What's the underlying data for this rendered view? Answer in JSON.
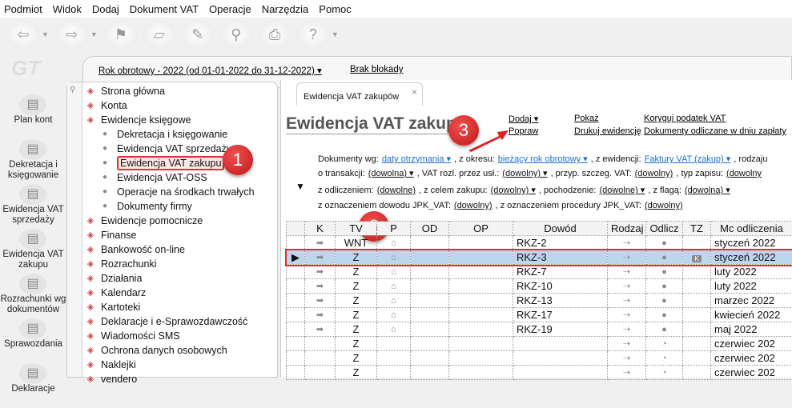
{
  "menu": [
    "Podmiot",
    "Widok",
    "Dodaj",
    "Dokument VAT",
    "Operacje",
    "Narzędzia",
    "Pomoc"
  ],
  "logo": "GT",
  "leftnav": [
    {
      "label": "Plan kont",
      "icon": "accounts-plan-icon"
    },
    {
      "label": "Dekretacja i księgowanie",
      "icon": "booking-icon"
    },
    {
      "label": "Ewidencja VAT sprzedaży",
      "icon": "vat-sales-icon"
    },
    {
      "label": "Ewidencja VAT zakupu",
      "icon": "vat-purchase-icon"
    },
    {
      "label": "Rozrachunki wg dokumentów",
      "icon": "settlements-icon"
    },
    {
      "label": "Sprawozdania",
      "icon": "reports-icon"
    },
    {
      "label": "Deklaracje",
      "icon": "declarations-icon"
    }
  ],
  "yearbar": {
    "year": "Rok obrotowy - 2022  (od 01-01-2022 do 31-12-2022) ▾",
    "lock": "Brak blokady"
  },
  "tree": [
    {
      "label": "Strona główna",
      "sub": false
    },
    {
      "label": "Konta",
      "sub": false
    },
    {
      "label": "Ewidencje księgowe",
      "sub": false
    },
    {
      "label": "Dekretacja i księgowanie",
      "sub": true
    },
    {
      "label": "Ewidencja VAT sprzedaży",
      "sub": true
    },
    {
      "label": "Ewidencja VAT zakupu",
      "sub": true,
      "selected": true
    },
    {
      "label": "Ewidencja VAT-OSS",
      "sub": true
    },
    {
      "label": "Operacje na środkach trwałych",
      "sub": true
    },
    {
      "label": "Dokumenty firmy",
      "sub": true
    },
    {
      "label": "Ewidencje pomocnicze",
      "sub": false
    },
    {
      "label": "Finanse",
      "sub": false
    },
    {
      "label": "Bankowość on-line",
      "sub": false
    },
    {
      "label": "Rozrachunki",
      "sub": false
    },
    {
      "label": "Działania",
      "sub": false
    },
    {
      "label": "Kalendarz",
      "sub": false
    },
    {
      "label": "Kartoteki",
      "sub": false
    },
    {
      "label": "Deklaracje i e-Sprawozdawczość",
      "sub": false
    },
    {
      "label": "Wiadomości SMS",
      "sub": false
    },
    {
      "label": "Ochrona danych osobowych",
      "sub": false
    },
    {
      "label": "Naklejki",
      "sub": false
    },
    {
      "label": "vendero",
      "sub": false
    }
  ],
  "tab": {
    "label": "Ewidencja VAT zakupów",
    "close": "×"
  },
  "title": "Ewidencja VAT zakupu",
  "actions": {
    "dodaj": "Dodaj ▾",
    "popraw": "Popraw",
    "pokaz": "Pokaż",
    "drukuj": "Drukuj ewidencję",
    "koryguj": "Koryguj podatek VAT",
    "odliczane": "Dokumenty odliczane w dniu zapłaty"
  },
  "filters": {
    "l1": [
      "Dokumenty wg:",
      "daty otrzymania ▾",
      ", z okresu:",
      "bieżący rok obrotowy ▾",
      ", z ewidencji:",
      "Faktury VAT (zakup) ▾",
      ", rodzaju"
    ],
    "l2": [
      "o transakcji:",
      "(dowolna) ▾",
      ", VAT rozl. przez usł.:",
      "(dowolny) ▾",
      ", przyp. szczeg. VAT:",
      "(dowolny)",
      ", typ zapisu:",
      "(dowolny"
    ],
    "l3": [
      "z odliczeniem:",
      "(dowolne)",
      ", z celem zakupu:",
      "(dowolny) ▾",
      ", pochodzenie:",
      "(dowolne) ▾",
      ", z flagą:",
      "(dowolna) ▾"
    ],
    "l4": [
      "z oznaczeniem dowodu JPK_VAT:",
      "(dowolny)",
      ", z oznaczeniem procedury JPK_VAT:",
      "(dowolny)"
    ]
  },
  "badges": [
    "1",
    "2",
    "3"
  ],
  "columns": [
    "",
    "K",
    "TV",
    "P",
    "OD",
    "OP",
    "Dowód",
    "Rodzaj",
    "Odlicz",
    "TZ",
    "Mc odliczenia"
  ],
  "rows": [
    {
      "tv": "WNT",
      "dowod": "RKZ-2",
      "tz": "",
      "mc": "styczeń 2022",
      "full": true
    },
    {
      "tv": "Z",
      "dowod": "RKZ-3",
      "tz": "K",
      "mc": "styczeń 2022",
      "full": true,
      "selected": true
    },
    {
      "tv": "Z",
      "dowod": "RKZ-7",
      "tz": "",
      "mc": "luty 2022",
      "full": true
    },
    {
      "tv": "Z",
      "dowod": "RKZ-10",
      "tz": "",
      "mc": "luty 2022",
      "full": true
    },
    {
      "tv": "Z",
      "dowod": "RKZ-13",
      "tz": "",
      "mc": "marzec 2022",
      "full": true
    },
    {
      "tv": "Z",
      "dowod": "RKZ-17",
      "tz": "",
      "mc": "kwiecień 2022",
      "full": true
    },
    {
      "tv": "Z",
      "dowod": "RKZ-19",
      "tz": "",
      "mc": "maj 2022",
      "full": true
    },
    {
      "tv": "Z",
      "dowod": "",
      "tz": "",
      "mc": "czerwiec 202",
      "full": false
    },
    {
      "tv": "Z",
      "dowod": "",
      "tz": "",
      "mc": "czerwiec 202",
      "full": false
    },
    {
      "tv": "Z",
      "dowod": "",
      "tz": "",
      "mc": "czerwiec 202",
      "full": false
    }
  ],
  "colors": {
    "selection": "#bcd6ee",
    "highlight": "#e03030",
    "link": "#1a6fd1"
  }
}
